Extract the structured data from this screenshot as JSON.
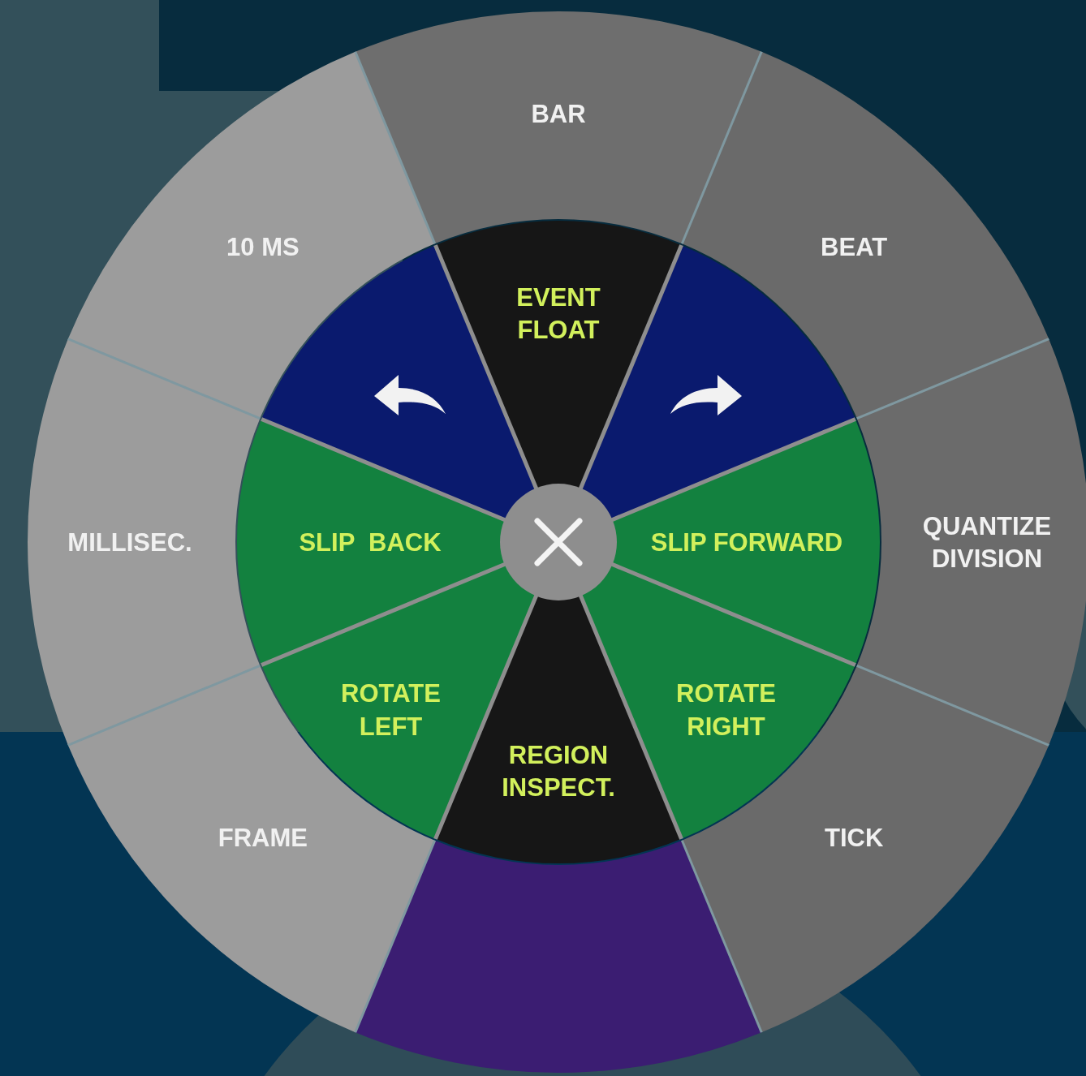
{
  "outer_ring": [
    {
      "lines": [
        "BAR"
      ],
      "color": "#6e6e6e"
    },
    {
      "lines": [
        "BEAT"
      ],
      "color": "#6a6a6a"
    },
    {
      "lines": [
        "QUANTIZE",
        "DIVISION"
      ],
      "color": "#6b6b6b"
    },
    {
      "lines": [
        "TICK"
      ],
      "color": "#6a6a6a"
    },
    {
      "color": "#3b1d72"
    },
    {
      "lines": [
        "FRAME"
      ],
      "color": "#9c9c9c"
    },
    {
      "lines": [
        "MILLISEC."
      ],
      "color": "#9c9c9c"
    },
    {
      "lines": [
        "10 MS"
      ],
      "color": "#9c9c9c"
    }
  ],
  "inner_rows": [
    [
      {
        "kind": "undo",
        "color": "#0a1a6e"
      },
      {
        "kind": "text",
        "lines": [
          "EVENT",
          "FLOAT"
        ],
        "color": "#161616"
      },
      {
        "kind": "redo",
        "color": "#0a1a6e"
      }
    ],
    [
      {
        "kind": "text",
        "lines": [
          "SLIP  BACK"
        ],
        "color": "#13813f"
      },
      {
        "kind": "text",
        "lines": [
          "SLIP FORWARD"
        ],
        "color": "#13813f"
      }
    ],
    [
      {
        "kind": "text",
        "lines": [
          "ROTATE",
          "LEFT"
        ],
        "color": "#13813f"
      },
      {
        "kind": "text",
        "lines": [
          "REGION",
          "INSPECT."
        ],
        "color": "#161616"
      },
      {
        "kind": "text",
        "lines": [
          "ROTATE",
          "RIGHT"
        ],
        "color": "#13813f"
      }
    ]
  ]
}
